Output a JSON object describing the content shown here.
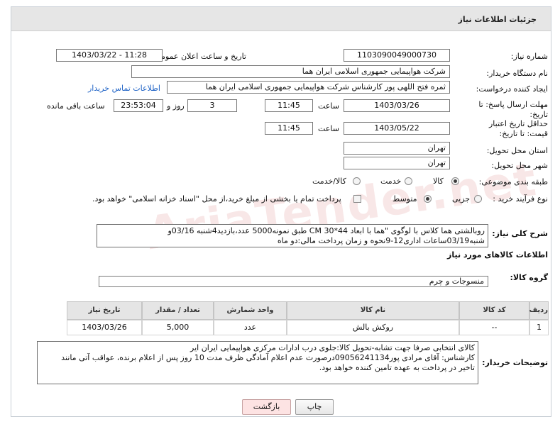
{
  "header": {
    "title": "جزئیات اطلاعات نیاز"
  },
  "form": {
    "need_number_label": "شماره نیاز:",
    "need_number": "1103090049000730",
    "announce_label": "تاریخ و ساعت اعلان عمومی:",
    "announce_value": "1403/03/22 - 11:28",
    "buyer_org_label": "نام دستگاه خریدار:",
    "buyer_org": "شرکت هواپیمایی جمهوری اسلامی ایران هما",
    "creator_label": "ایجاد کننده درخواست:",
    "creator": "ثمره فتح اللهی پور کارشناس شرکت هواپیمایی جمهوری اسلامی ایران هما",
    "contact_link": "اطلاعات تماس خریدار",
    "deadline_label": "مهلت ارسال پاسخ: تا تاریخ:",
    "deadline_date": "1403/03/26",
    "time_label": "ساعت",
    "deadline_time": "11:45",
    "days_value": "3",
    "days_label": "روز و",
    "remaining_time": "23:53:04",
    "remaining_label": "ساعت باقی مانده",
    "price_validity_label": "حداقل تاریخ اعتبار قیمت: تا تاریخ:",
    "price_validity_date": "1403/05/22",
    "price_validity_time": "11:45",
    "province_label": "استان محل تحویل:",
    "province": "تهران",
    "city_label": "شهر محل تحویل:",
    "city": "تهران",
    "category_label": "طبقه بندی موضوعی:",
    "category_options": [
      "کالا",
      "خدمت",
      "کالا/خدمت"
    ],
    "process_label": "نوع فرآیند خرید :",
    "process_options": [
      "جزیی",
      "متوسط"
    ],
    "payment_note": "پرداخت تمام یا بخشی از مبلغ خرید،از محل \"اسناد خزانه اسلامی\" خواهد بود.",
    "description_label": "شرح کلی نیاز:",
    "description_line1": "روبالشتی هما کلاس با لوگوی \"هما با ابعاد 44*30 CM طبق نمونه5000 عدد،بازدید4شنبه 03/16و",
    "description_line2": "شنبه03/19ساعات اداری12-9نحوه و زمان پرداخت مالی:دو ماه",
    "goods_info_heading": "اطلاعات کالاهای مورد نیاز",
    "goods_group_label": "گروه کالا:",
    "goods_group": "منسوجات و چرم"
  },
  "table": {
    "headers": [
      "ردیف",
      "کد کالا",
      "نام کالا",
      "واحد شمارش",
      "تعداد / مقدار",
      "تاریخ نیاز"
    ],
    "rows": [
      [
        "1",
        "--",
        "روکش بالش",
        "عدد",
        "5,000",
        "1403/03/26"
      ]
    ]
  },
  "buyer_notes": {
    "label": "توضیحات خریدار:",
    "line1": "کالای انتخابی صرفا جهت تشابه-تحویل کالا:جلوی درب ادارات مرکزی هواپیمایی ایران ایر",
    "line2": "کارشناس: آقای مرادی پور09056241134درصورت عدم اعلام آمادگی ظرف مدت 10 روز پس از اعلام برنده، عواقب آتی مانند",
    "line3": "تاخیر در پرداخت به عهده تامین کننده خواهد بود."
  },
  "buttons": {
    "print": "چاپ",
    "back": "بازگشت"
  },
  "watermark": "AriaTender.net"
}
